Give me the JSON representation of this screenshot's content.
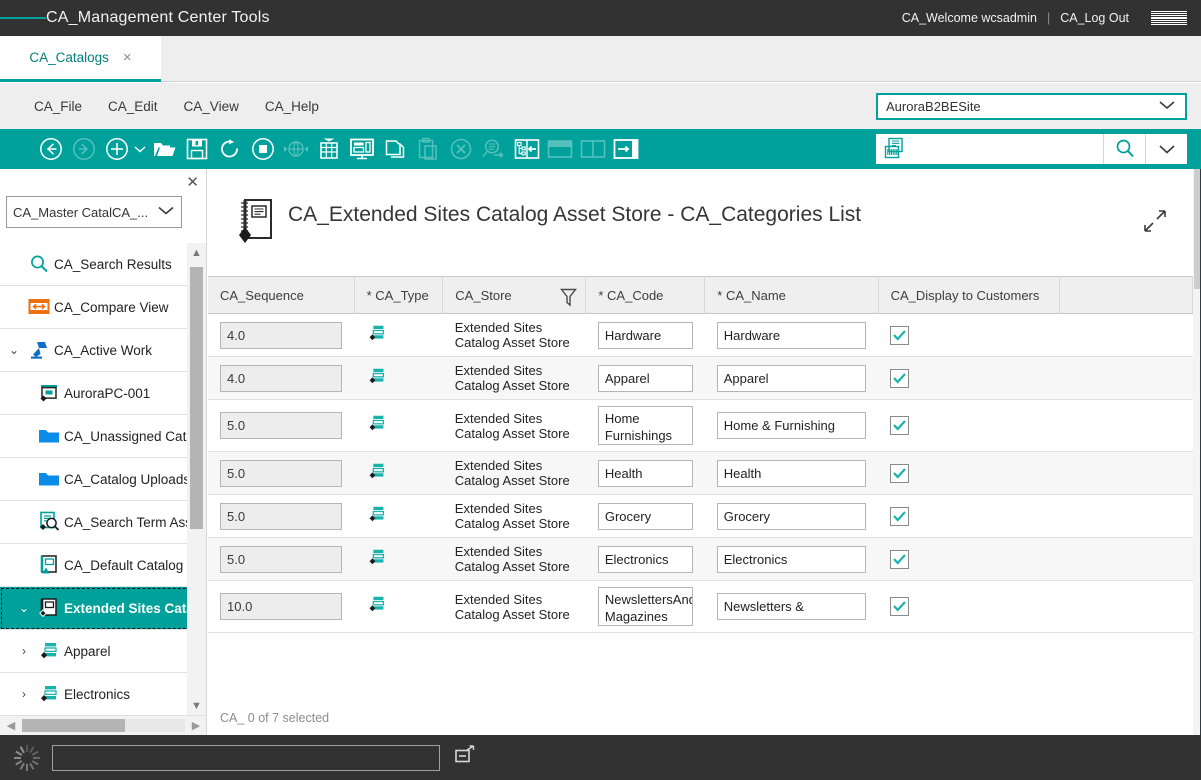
{
  "topbar": {
    "menu_icon": "hamburger-icon",
    "title": "CA_Management Center Tools",
    "welcome": "CA_Welcome wcsadmin",
    "separator": "|",
    "logout": "CA_Log Out",
    "brand": "IBM",
    "bg": "#323232",
    "accent": "#00a19b"
  },
  "tabs": [
    {
      "label": "CA_Catalogs",
      "close": "×",
      "active": true
    }
  ],
  "menubar": {
    "items": [
      {
        "label": "CA_File"
      },
      {
        "label": "CA_Edit"
      },
      {
        "label": "CA_View"
      },
      {
        "label": "CA_Help"
      }
    ],
    "site_select": {
      "value": "AuroraB2BESite",
      "chevron": "chevron-down-icon"
    }
  },
  "toolbar": {
    "buttons": [
      {
        "name": "back-icon",
        "enabled": true
      },
      {
        "name": "forward-icon",
        "enabled": false
      },
      {
        "name": "new-icon",
        "enabled": true
      },
      {
        "name": "new-dropdown-caret-icon",
        "enabled": true
      },
      {
        "name": "open-folder-icon",
        "enabled": true
      },
      {
        "name": "save-icon",
        "enabled": true
      },
      {
        "name": "refresh-icon",
        "enabled": true
      },
      {
        "name": "stop-icon",
        "enabled": true
      },
      {
        "name": "globe-icon",
        "enabled": false
      },
      {
        "name": "table-icon",
        "enabled": true
      },
      {
        "name": "preview-monitor-icon",
        "enabled": true
      },
      {
        "name": "copy-icon",
        "enabled": true
      },
      {
        "name": "paste-icon",
        "enabled": false
      },
      {
        "name": "delete-icon",
        "enabled": false
      },
      {
        "name": "find-icon",
        "enabled": false
      },
      {
        "name": "show-in-tree-icon",
        "enabled": true
      },
      {
        "name": "split-horizontal-icon",
        "enabled": false
      },
      {
        "name": "split-vertical-icon",
        "enabled": false
      },
      {
        "name": "open-in-panel-icon",
        "enabled": true
      }
    ],
    "search": {
      "icon": "catalog-search-icon",
      "value": "",
      "placeholder": "",
      "search_icon": "search-icon",
      "dropdown_icon": "chevron-down-icon"
    }
  },
  "explorer": {
    "close_icon": "close-icon",
    "catalog_select": {
      "value": "CA_Master CatalCA_...",
      "chevron": "chevron-down-icon"
    },
    "tree": [
      {
        "label": "CA_Search Results",
        "icon": "search-icon",
        "twisty": "",
        "indent": 0,
        "selected": false
      },
      {
        "label": "CA_Compare View",
        "icon": "compare-view-icon",
        "twisty": "",
        "indent": 0,
        "selected": false
      },
      {
        "label": "CA_Active Work",
        "icon": "active-work-icon",
        "twisty": "⌄",
        "indent": 0,
        "selected": false
      },
      {
        "label": "AuroraPC-001",
        "icon": "workspace-icon",
        "twisty": "",
        "indent": 1,
        "selected": false
      },
      {
        "label": "CA_Unassigned Catalog",
        "icon": "folder-icon",
        "twisty": "",
        "indent": 1,
        "selected": false
      },
      {
        "label": "CA_Catalog Uploads",
        "icon": "folder-icon",
        "twisty": "",
        "indent": 1,
        "selected": false
      },
      {
        "label": "CA_Search Term Asso",
        "icon": "search-term-assoc-icon",
        "twisty": "",
        "indent": 1,
        "selected": false
      },
      {
        "label": "CA_Default Catalog",
        "icon": "catalog-icon",
        "twisty": "",
        "indent": 1,
        "selected": false
      },
      {
        "label": "Extended Sites Catalog",
        "icon": "catalog-icon",
        "twisty": "⌄",
        "indent": 1,
        "selected": true
      },
      {
        "label": "Apparel",
        "icon": "category-icon",
        "twisty": "›",
        "indent": 2,
        "selected": false
      },
      {
        "label": "Electronics",
        "icon": "category-icon",
        "twisty": "›",
        "indent": 2,
        "selected": false
      }
    ],
    "scroll_up_icon": "chevron-up-icon",
    "scroll_down_icon": "chevron-down-icon",
    "scroll_left_icon": "chevron-left-icon",
    "scroll_right_icon": "chevron-right-icon"
  },
  "main": {
    "page_icon": "catalog-asset-store-icon",
    "title": "CA_Extended Sites Catalog Asset Store - CA_Categories List",
    "expand_icon": "expand-icon",
    "columns": [
      {
        "label": "CA_Sequence",
        "required": false,
        "filter": false
      },
      {
        "label": "CA_Type",
        "required": true,
        "filter": false
      },
      {
        "label": "CA_Store",
        "required": false,
        "filter": true
      },
      {
        "label": "CA_Code",
        "required": true,
        "filter": false
      },
      {
        "label": "CA_Name",
        "required": true,
        "filter": false
      },
      {
        "label": "CA_Display to Customers",
        "required": false,
        "filter": false
      },
      {
        "label": "",
        "required": false,
        "filter": false
      }
    ],
    "required_marker": "*",
    "rows": [
      {
        "sequence": "4.0",
        "type_icon": "category-icon",
        "store": "Extended Sites Catalog Asset Store",
        "code": "Hardware",
        "name": "Hardware",
        "display": true
      },
      {
        "sequence": "4.0",
        "type_icon": "category-icon",
        "store": "Extended Sites Catalog Asset Store",
        "code": "Apparel",
        "name": "Apparel",
        "display": true
      },
      {
        "sequence": "5.0",
        "type_icon": "category-icon",
        "store": "Extended Sites Catalog Asset Store",
        "code": "Home Furnishings",
        "name": "Home & Furnishing",
        "display": true
      },
      {
        "sequence": "5.0",
        "type_icon": "category-icon",
        "store": "Extended Sites Catalog Asset Store",
        "code": "Health",
        "name": "Health",
        "display": true
      },
      {
        "sequence": "5.0",
        "type_icon": "category-icon",
        "store": "Extended Sites Catalog Asset Store",
        "code": "Grocery",
        "name": "Grocery",
        "display": true
      },
      {
        "sequence": "5.0",
        "type_icon": "category-icon",
        "store": "Extended Sites Catalog Asset Store",
        "code": "Electronics",
        "name": "Electronics",
        "display": true
      },
      {
        "sequence": "10.0",
        "type_icon": "category-icon",
        "store": "Extended Sites Catalog Asset Store",
        "code": "NewslettersAndMagazines",
        "name": "Newsletters & Magazines",
        "display": true
      }
    ],
    "status": "CA_ 0 of 7 selected"
  },
  "bottombar": {
    "spinner_icon": "loading-spinner-icon",
    "input_value": "",
    "restore_icon": "restore-window-icon"
  }
}
